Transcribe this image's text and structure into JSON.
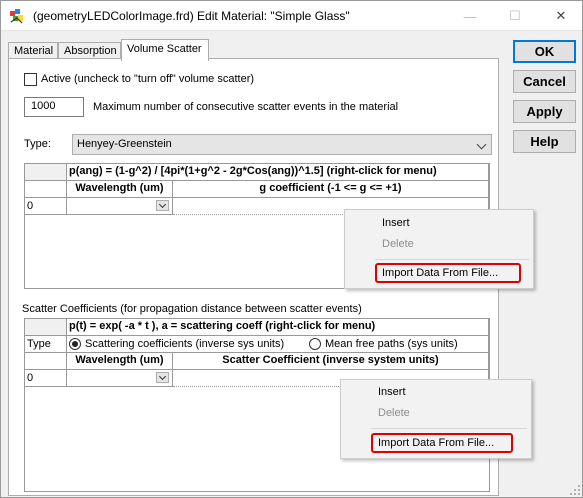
{
  "window": {
    "title": "(geometryLEDColorImage.frd) Edit Material: \"Simple Glass\"",
    "minimize_glyph": "—",
    "maximize_glyph": "☐",
    "close_glyph": "✕"
  },
  "tabs": [
    {
      "label": "Material",
      "active": false
    },
    {
      "label": "Absorption",
      "active": false
    },
    {
      "label": "Volume Scatter",
      "active": true
    }
  ],
  "side_buttons": {
    "ok": "OK",
    "cancel": "Cancel",
    "apply": "Apply",
    "help": "Help"
  },
  "volume_scatter": {
    "active_checked": false,
    "active_label": "Active  (uncheck to \"turn off\" volume scatter)",
    "max_events_value": "1000",
    "max_events_label": "Maximum number of consecutive scatter events in the material",
    "type_label": "Type:",
    "type_value": "Henyey-Greenstein"
  },
  "g_table": {
    "formula": "p(ang) = (1-g^2) / [4pi*(1+g^2 - 2g*Cos(ang))^1.5]     (right-click for menu)",
    "col_wavelength": "Wavelength (um)",
    "col_g": "g coefficient  (-1 <= g <= +1)",
    "row_index": "0"
  },
  "context_menu_1": {
    "items": [
      {
        "label": "Insert",
        "enabled": true
      },
      {
        "label": "Delete",
        "enabled": false
      },
      {
        "label": "Import Data From File...",
        "enabled": true,
        "highlighted": true
      }
    ]
  },
  "scatter_coeff": {
    "section_label": "Scatter Coefficients  (for propagation distance between scatter events)",
    "formula": "p(t) = exp( -a * t ),    a = scattering coeff     (right-click for menu)",
    "type_row_label": "Type",
    "radio_1_label": "Scattering coefficients (inverse sys units)",
    "radio_1_selected": true,
    "radio_2_label": "Mean free paths (sys units)",
    "radio_2_selected": false,
    "col_wavelength": "Wavelength (um)",
    "col_coeff": "Scatter Coefficient (inverse system units)",
    "row_index": "0"
  },
  "context_menu_2": {
    "items": [
      {
        "label": "Insert",
        "enabled": true
      },
      {
        "label": "Delete",
        "enabled": false
      },
      {
        "label": "Import Data From File...",
        "enabled": true,
        "highlighted": true
      }
    ]
  },
  "colors": {
    "highlight_border": "#e00000",
    "default_button_border": "#0078d7"
  }
}
